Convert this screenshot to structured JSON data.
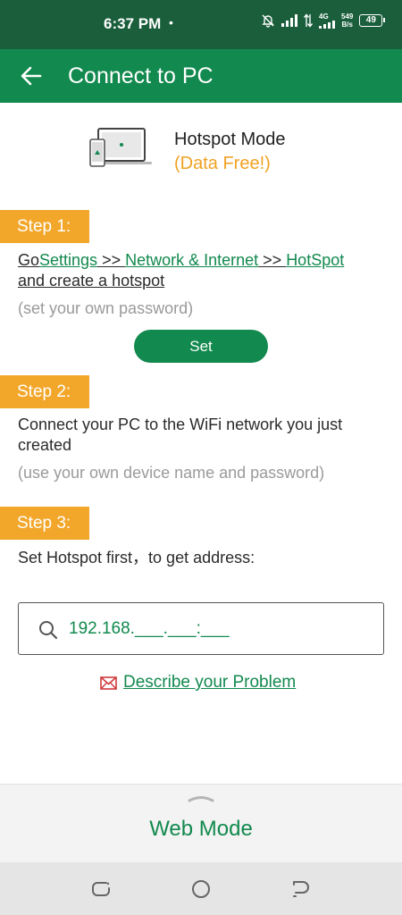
{
  "status_bar": {
    "time": "6:37 PM",
    "dot": "•",
    "network": "4G",
    "speed_value": "549",
    "speed_unit": "B/s",
    "battery": "49"
  },
  "app_bar": {
    "title": "Connect to PC",
    "back_icon": "arrow-left-icon"
  },
  "hotspot": {
    "title": "Hotspot Mode",
    "subtitle": "(Data Free!)"
  },
  "steps": [
    {
      "label": "Step 1:",
      "go": "Go",
      "settings": "Settings",
      "sep1": " >> ",
      "network": "Network & Internet",
      "sep2": " >> ",
      "hotspot": "HotSpot",
      "create": "and create a hotspot",
      "hint": "(set your own password)",
      "button": "Set"
    },
    {
      "label": "Step 2:",
      "text": "Connect your PC to the WiFi network you just created",
      "hint": "(use your own device name and password)"
    },
    {
      "label": "Step 3:",
      "text": "Set Hotspot first，to get address:"
    }
  ],
  "address": {
    "value": "192.168.___.___:___",
    "icon": "search-icon"
  },
  "problem_link": {
    "label": "Describe your Problem",
    "icon": "mail-icon"
  },
  "bottom_sheet": {
    "label": "Web Mode"
  },
  "colors": {
    "status_bar": "#1a5e3c",
    "primary": "#12894e",
    "accent": "#f2a72b",
    "hint": "#9a9a9a"
  }
}
